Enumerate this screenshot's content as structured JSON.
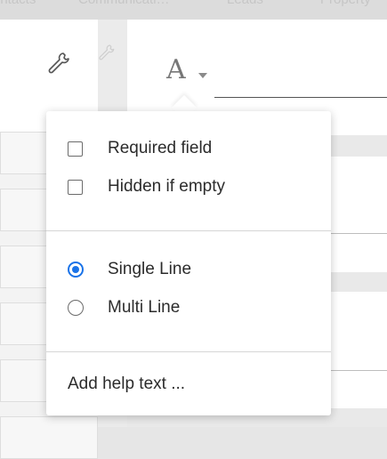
{
  "top_tabs": [
    "intacts",
    "Communicati…",
    "Leads",
    "Property"
  ],
  "field_settings": {
    "font_icon_glyph": "A",
    "options": {
      "required_field": {
        "label": "Required field",
        "checked": false
      },
      "hidden_if_empty": {
        "label": "Hidden if empty",
        "checked": false
      }
    },
    "line_mode": {
      "single_line": {
        "label": "Single Line",
        "selected": true
      },
      "multi_line": {
        "label": "Multi Line",
        "selected": false
      }
    },
    "help_link": "Add help text ..."
  },
  "colors": {
    "accent": "#1a73e8",
    "text": "#2b2b2b"
  }
}
